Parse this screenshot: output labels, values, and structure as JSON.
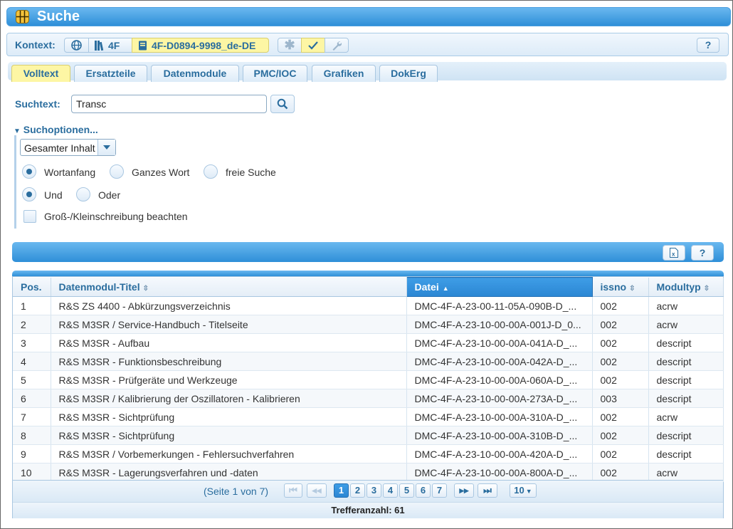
{
  "app": {
    "title": "Suche"
  },
  "context": {
    "label": "Kontext:",
    "segment_4f": "4F",
    "document": "4F-D0894-9998_de-DE",
    "help": "?"
  },
  "tabs": [
    "Volltext",
    "Ersatzteile",
    "Datenmodule",
    "PMC/IOC",
    "Grafiken",
    "DokErg"
  ],
  "search": {
    "label": "Suchtext:",
    "value": "Transc",
    "options_label": "Suchoptionen...",
    "scope_selected": "Gesamter Inhalt",
    "match_options": [
      "Wortanfang",
      "Ganzes Wort",
      "freie Suche"
    ],
    "match_selected": "Wortanfang",
    "logic_options": [
      "Und",
      "Oder"
    ],
    "logic_selected": "Und",
    "case_label": "Groß-/Kleinschreibung beachten",
    "case_checked": false
  },
  "toolbar": {
    "help": "?"
  },
  "results": {
    "columns": [
      "Pos.",
      "Datenmodul-Titel",
      "Datei",
      "issno",
      "Modultyp"
    ],
    "sorted_column": "Datei",
    "rows": [
      [
        "1",
        "R&S ZS 4400 - Abkürzungsverzeichnis",
        "DMC-4F-A-23-00-11-05A-090B-D_...",
        "002",
        "acrw"
      ],
      [
        "2",
        "R&S M3SR / Service-Handbuch - Titelseite",
        "DMC-4F-A-23-10-00-00A-001J-D_0...",
        "002",
        "acrw"
      ],
      [
        "3",
        "R&S M3SR - Aufbau",
        "DMC-4F-A-23-10-00-00A-041A-D_...",
        "002",
        "descript"
      ],
      [
        "4",
        "R&S M3SR - Funktionsbeschreibung",
        "DMC-4F-A-23-10-00-00A-042A-D_...",
        "002",
        "descript"
      ],
      [
        "5",
        "R&S M3SR - Prüfgeräte und Werkzeuge",
        "DMC-4F-A-23-10-00-00A-060A-D_...",
        "002",
        "descript"
      ],
      [
        "6",
        "R&S M3SR / Kalibrierung der Oszillatoren - Kalibrieren",
        "DMC-4F-A-23-10-00-00A-273A-D_...",
        "003",
        "descript"
      ],
      [
        "7",
        "R&S M3SR - Sichtprüfung",
        "DMC-4F-A-23-10-00-00A-310A-D_...",
        "002",
        "acrw"
      ],
      [
        "8",
        "R&S M3SR - Sichtprüfung",
        "DMC-4F-A-23-10-00-00A-310B-D_...",
        "002",
        "descript"
      ],
      [
        "9",
        "R&S M3SR / Vorbemerkungen - Fehlersuchverfahren",
        "DMC-4F-A-23-10-00-00A-420A-D_...",
        "002",
        "descript"
      ],
      [
        "10",
        "R&S M3SR - Lagerungsverfahren und -daten",
        "DMC-4F-A-23-10-00-00A-800A-D_...",
        "002",
        "acrw"
      ]
    ]
  },
  "pager": {
    "info": "(Seite 1 von 7)",
    "pages": [
      "1",
      "2",
      "3",
      "4",
      "5",
      "6",
      "7"
    ],
    "current": "1",
    "page_size": "10"
  },
  "footer": {
    "hits": "Trefferanzahl: 61"
  }
}
